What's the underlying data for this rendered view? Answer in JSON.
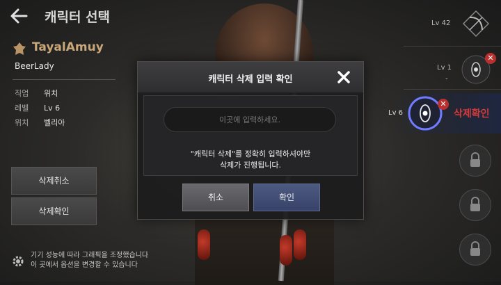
{
  "header": {
    "title": "캐릭터 선택"
  },
  "character": {
    "name": "TayalAmuy",
    "family": "BeerLady",
    "info": [
      {
        "key": "직업",
        "value": "위치"
      },
      {
        "key": "레벨",
        "value": "Lv 6"
      },
      {
        "key": "위치",
        "value": "벨리아"
      }
    ]
  },
  "side_buttons": {
    "cancel_delete": "삭제취소",
    "confirm_delete": "삭제확인"
  },
  "settings_note": {
    "line1": "기기 성능에 따라 그래픽을 조정했습니다",
    "line2": "이 곳에서 옵션을 변경할 수 있습니다"
  },
  "slots": {
    "slot1_level": "Lv 42",
    "slot2_level": "Lv 1",
    "slot2_sub": "-",
    "slot3_level": "Lv 6",
    "slot3_status": "삭제확인"
  },
  "modal": {
    "title": "캐릭터 삭제 입력 확인",
    "input_placeholder": "이곳에 입력하세요.",
    "input_value": "",
    "instruction_line1": "\"캐릭터 삭제\"를 정확히 입력하셔야만",
    "instruction_line2": "삭제가 진행됩니다.",
    "cancel_label": "취소",
    "confirm_label": "확인"
  },
  "colors": {
    "name_gold": "#c9a77a",
    "delete_red": "#d23b3b",
    "confirm_blue": "#38426a",
    "slot_glow": "#6f7cff"
  }
}
